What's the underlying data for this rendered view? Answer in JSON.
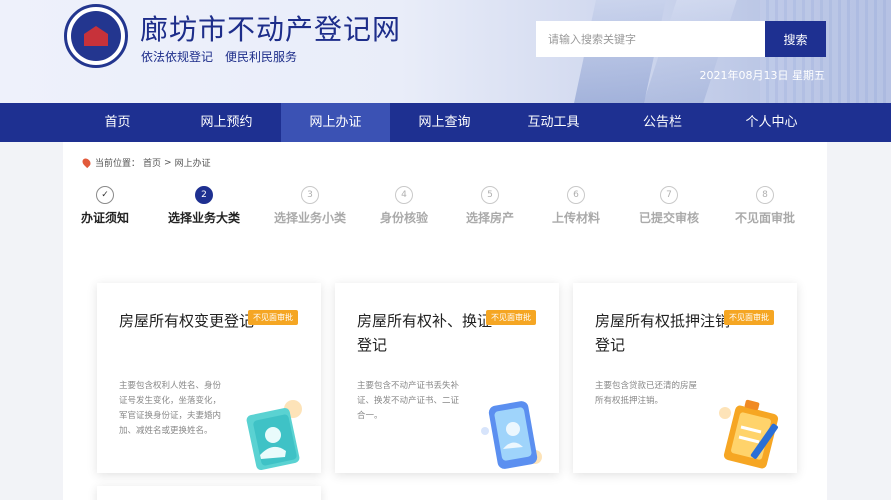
{
  "header": {
    "site_title": "廊坊市不动产登记网",
    "slogan_1": "依法依规登记",
    "slogan_2": "便民利民服务",
    "search_placeholder": "请输入搜索关键字",
    "search_button": "搜索",
    "date": "2021年08月13日 星期五"
  },
  "nav": [
    {
      "label": "首页"
    },
    {
      "label": "网上预约"
    },
    {
      "label": "网上办证"
    },
    {
      "label": "网上查询"
    },
    {
      "label": "互动工具"
    },
    {
      "label": "公告栏"
    },
    {
      "label": "个人中心"
    }
  ],
  "breadcrumb": {
    "prefix": "当前位置：",
    "home": "首页",
    "sep": ">",
    "current": "网上办证"
  },
  "steps": [
    {
      "num": "✓",
      "label": "办证须知"
    },
    {
      "num": "2",
      "label": "选择业务大类"
    },
    {
      "num": "3",
      "label": "选择业务小类"
    },
    {
      "num": "4",
      "label": "身份核验"
    },
    {
      "num": "5",
      "label": "选择房产"
    },
    {
      "num": "6",
      "label": "上传材料"
    },
    {
      "num": "7",
      "label": "已提交审核"
    },
    {
      "num": "8",
      "label": "不见面审批"
    }
  ],
  "cards": [
    {
      "title": "房屋所有权变更登记",
      "badge": "不见面审批",
      "desc": "主要包含权利人姓名、身份证号发生变化，坐落变化，军官证换身份证，夫妻婚内加、减姓名或更换姓名。"
    },
    {
      "title": "房屋所有权补、换证登记",
      "badge": "不见面审批",
      "desc": "主要包含不动产证书丢失补证、换发不动产证书、二证合一。"
    },
    {
      "title": "房屋所有权抵押注销登记",
      "badge": "不见面审批",
      "desc": "主要包含贷款已还清的房屋所有权抵押注销。"
    }
  ],
  "colors": {
    "primary": "#1e3091",
    "nav_active": "#3b52b4",
    "badge": "#f5a623"
  }
}
